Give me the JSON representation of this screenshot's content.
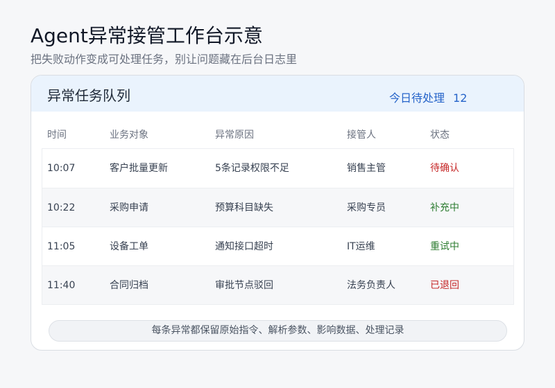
{
  "page": {
    "title": "Agent异常接管工作台示意",
    "subtitle": "把失败动作变成可处理任务，别让问题藏在后台日志里"
  },
  "panel": {
    "title": "异常任务队列",
    "pending_label": "今日待处理",
    "pending_count": "12",
    "columns": [
      "时间",
      "业务对象",
      "异常原因",
      "接管人",
      "状态"
    ],
    "rows": [
      {
        "time": "10:07",
        "object": "客户批量更新",
        "reason": "5条记录权限不足",
        "assignee": "销售主管",
        "status": "待确认"
      },
      {
        "time": "10:22",
        "object": "采购申请",
        "reason": "预算科目缺失",
        "assignee": "采购专员",
        "status": "补充中"
      },
      {
        "time": "11:05",
        "object": "设备工单",
        "reason": "通知接口超时",
        "assignee": "IT运维",
        "status": "重试中"
      },
      {
        "time": "11:40",
        "object": "合同归档",
        "reason": "审批节点驳回",
        "assignee": "法务负责人",
        "status": "已退回"
      }
    ],
    "footer_note": "每条异常都保留原始指令、解析参数、影响数据、处理记录"
  },
  "colors": {
    "status_danger": "#c62828",
    "status_success": "#2e7d32",
    "accent": "#2563c9",
    "header_bg": "#eaf3fd"
  }
}
